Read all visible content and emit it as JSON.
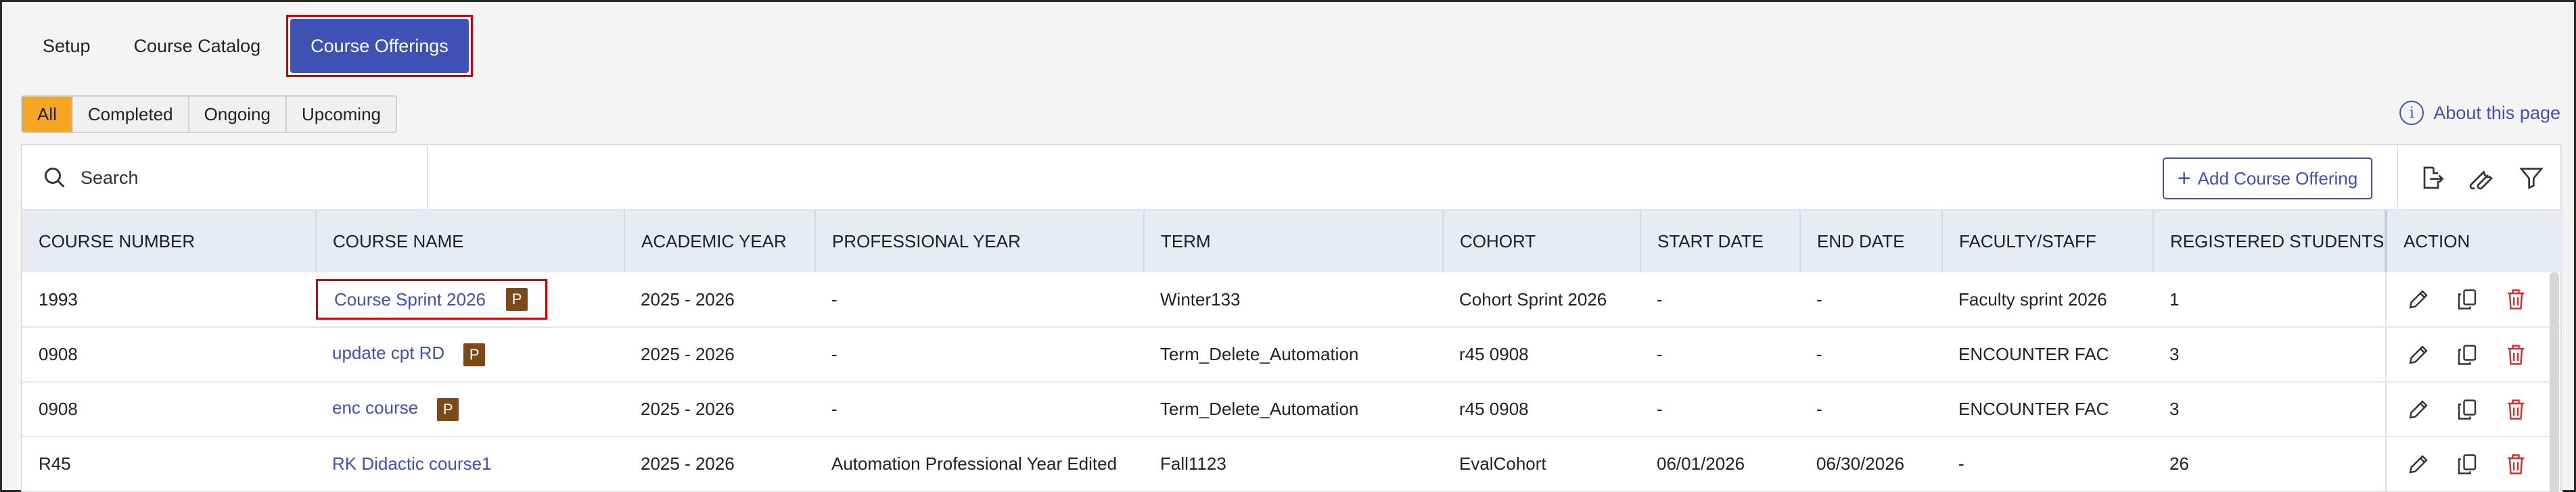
{
  "top_tabs": {
    "setup": "Setup",
    "catalog": "Course Catalog",
    "offerings": "Course Offerings"
  },
  "filters": [
    "All",
    "Completed",
    "Ongoing",
    "Upcoming"
  ],
  "about_label": "About this page",
  "search": {
    "placeholder": "Search"
  },
  "add_button": "Add Course Offering",
  "columns": [
    "COURSE NUMBER",
    "COURSE NAME",
    "ACADEMIC YEAR",
    "PROFESSIONAL YEAR",
    "TERM",
    "COHORT",
    "START DATE",
    "END DATE",
    "FACULTY/STAFF",
    "REGISTERED STUDENTS",
    "ACTION"
  ],
  "rows": [
    {
      "number": "1993",
      "name": "Course Sprint 2026",
      "badge": "P",
      "academic_year": "2025 - 2026",
      "professional_year": "-",
      "term": "Winter133",
      "cohort": "Cohort Sprint 2026",
      "start": "-",
      "end": "-",
      "faculty": "Faculty sprint 2026",
      "registered": "1"
    },
    {
      "number": "0908",
      "name": "update cpt RD",
      "badge": "P",
      "academic_year": "2025 - 2026",
      "professional_year": "-",
      "term": "Term_Delete_Automation",
      "cohort": "r45 0908",
      "start": "-",
      "end": "-",
      "faculty": "ENCOUNTER FAC",
      "registered": "3"
    },
    {
      "number": "0908",
      "name": "enc course",
      "badge": "P",
      "academic_year": "2025 - 2026",
      "professional_year": "-",
      "term": "Term_Delete_Automation",
      "cohort": "r45 0908",
      "start": "-",
      "end": "-",
      "faculty": "ENCOUNTER FAC",
      "registered": "3"
    },
    {
      "number": "R45",
      "name": "RK Didactic course1",
      "badge": "",
      "academic_year": "2025 - 2026",
      "professional_year": "Automation Professional Year Edited",
      "term": "Fall1123",
      "cohort": "EvalCohort",
      "start": "06/01/2026",
      "end": "06/30/2026",
      "faculty": "-",
      "registered": "26"
    }
  ],
  "colors": {
    "accent": "#3f51b5",
    "active_filter": "#f5a623",
    "badge": "#7b4a16",
    "delete": "#d32f2f",
    "highlight": "#d40000"
  }
}
